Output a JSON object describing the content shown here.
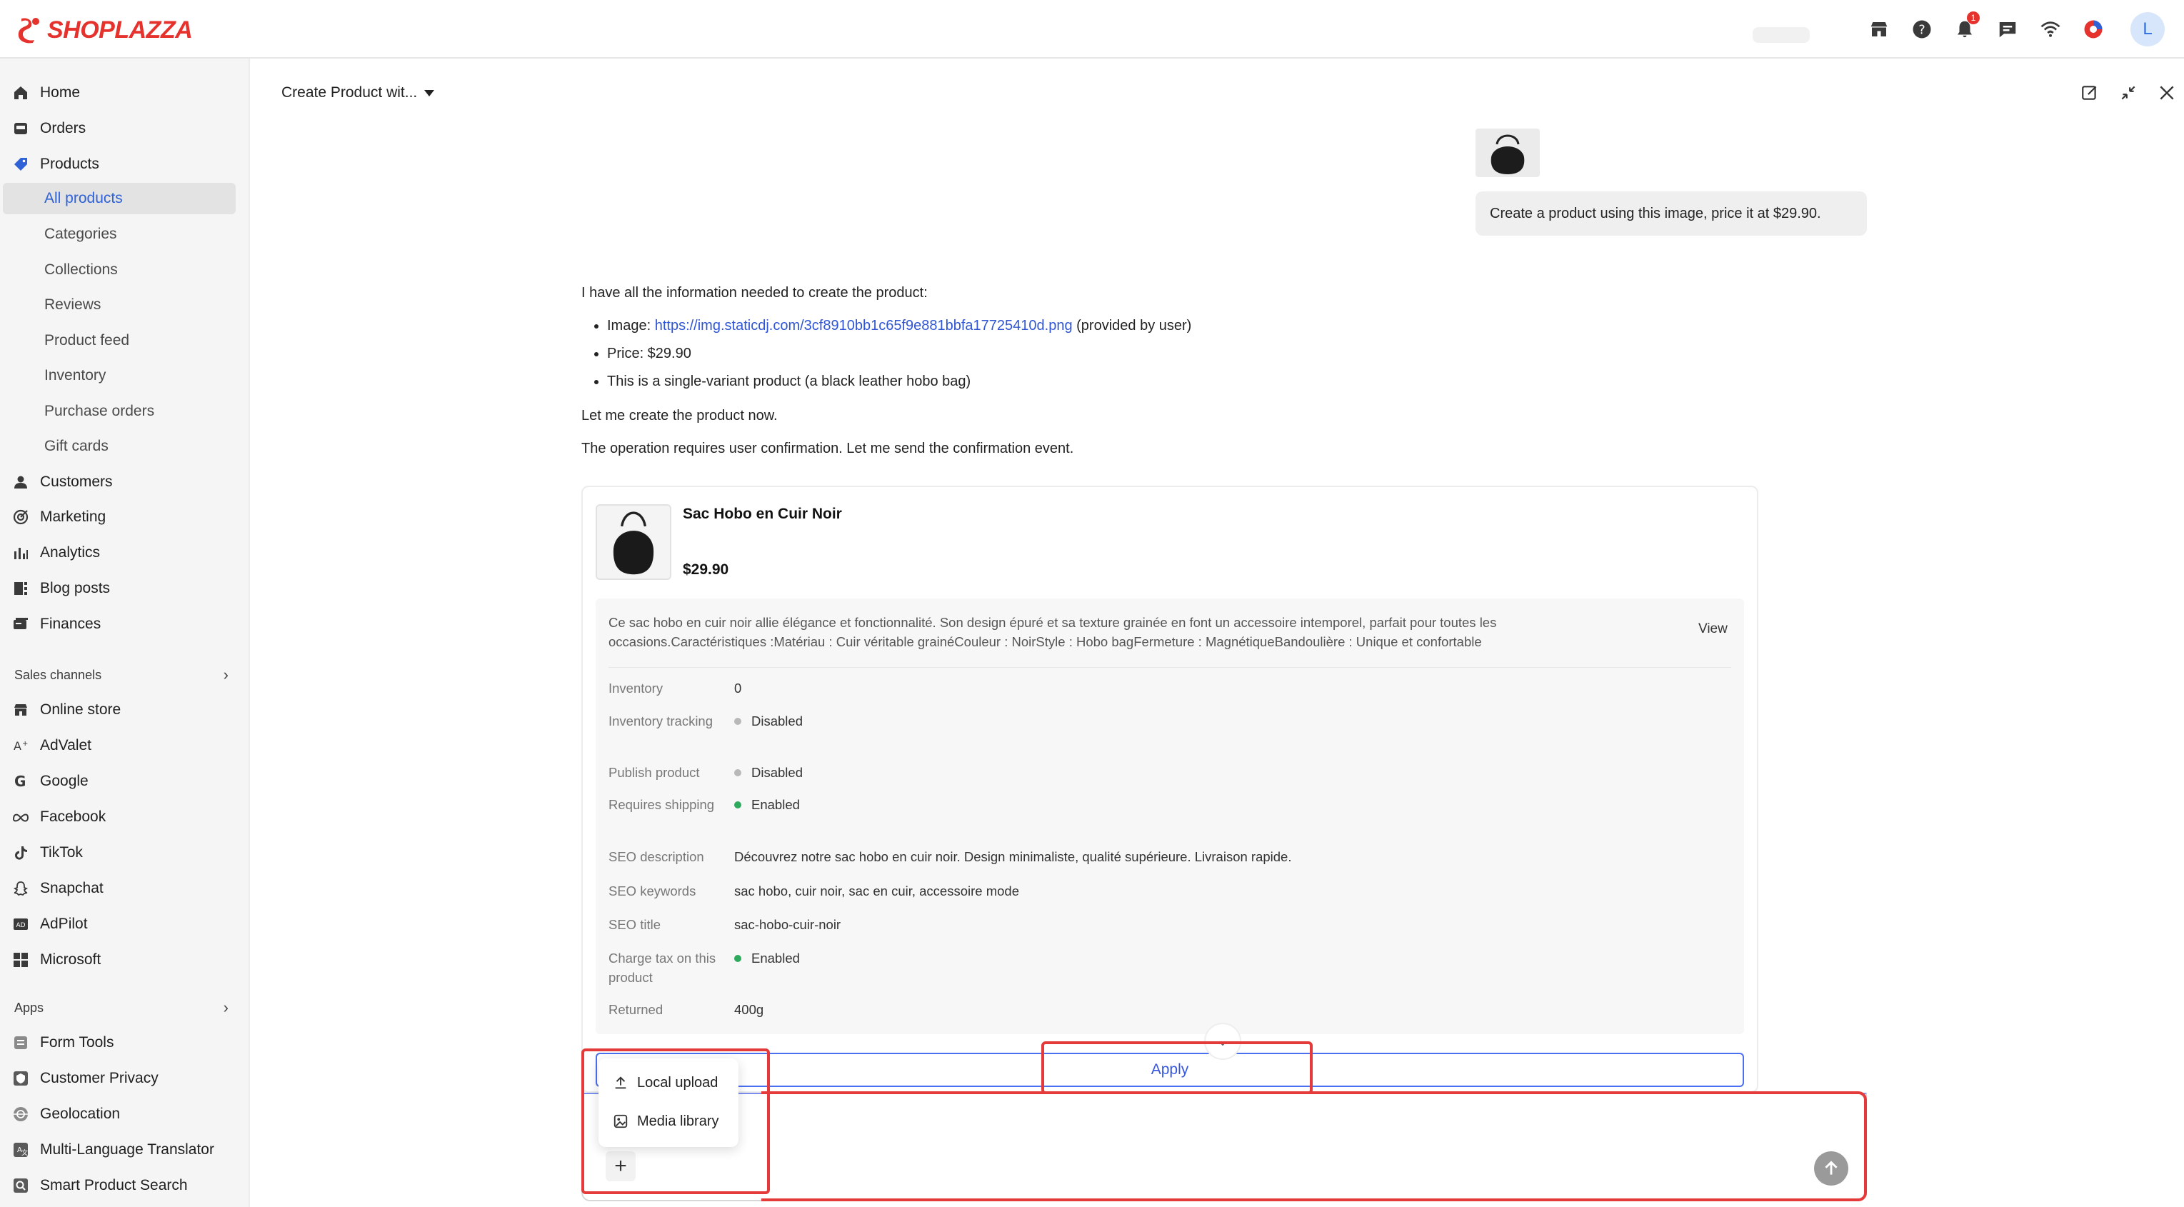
{
  "brand": {
    "name": "SHOPLAZZA",
    "color": "#e5322d"
  },
  "topbar": {
    "icons": [
      "store-icon",
      "help-icon",
      "bell-icon",
      "chat-icon",
      "wifi-icon",
      "color-circle-icon"
    ],
    "notification_count": "1",
    "avatar_initial": "L"
  },
  "sidebar": {
    "main": [
      {
        "label": "Home",
        "icon": "home-icon"
      },
      {
        "label": "Orders",
        "icon": "orders-icon"
      },
      {
        "label": "Products",
        "icon": "tag-icon"
      }
    ],
    "product_subs": [
      "All products",
      "Categories",
      "Collections",
      "Reviews",
      "Product feed",
      "Inventory",
      "Purchase orders",
      "Gift cards"
    ],
    "more": [
      {
        "label": "Customers",
        "icon": "person-icon"
      },
      {
        "label": "Marketing",
        "icon": "target-icon"
      },
      {
        "label": "Analytics",
        "icon": "bar-chart-icon"
      },
      {
        "label": "Blog posts",
        "icon": "blog-icon"
      },
      {
        "label": "Finances",
        "icon": "finance-icon"
      }
    ],
    "sales_channels_label": "Sales channels",
    "sales_channels": [
      {
        "label": "Online store",
        "icon": "store-icon"
      },
      {
        "label": "AdValet",
        "icon": "advalet-icon"
      },
      {
        "label": "Google",
        "icon": "google-icon"
      },
      {
        "label": "Facebook",
        "icon": "meta-icon"
      },
      {
        "label": "TikTok",
        "icon": "tiktok-icon"
      },
      {
        "label": "Snapchat",
        "icon": "snapchat-icon"
      },
      {
        "label": "AdPilot",
        "icon": "adpilot-icon"
      },
      {
        "label": "Microsoft",
        "icon": "microsoft-icon"
      }
    ],
    "apps_label": "Apps",
    "apps": [
      {
        "label": "Form Tools",
        "icon": "form-icon"
      },
      {
        "label": "Customer Privacy",
        "icon": "shield-icon"
      },
      {
        "label": "Geolocation",
        "icon": "globe-icon"
      },
      {
        "label": "Multi-Language Translator",
        "icon": "translate-icon"
      },
      {
        "label": "Smart Product Search",
        "icon": "search-icon"
      }
    ]
  },
  "chat": {
    "title": "Create Product wit...",
    "user_message": "Create a product using this image, price it at $29.90.",
    "assistant": {
      "intro": "I have all the information needed to create the product:",
      "image_prefix": "Image: ",
      "image_url": "https://img.staticdj.com/3cf8910bb1c65f9e881bbfa17725410d.png",
      "image_suffix": " (provided by user)",
      "price_line": "Price: $29.90",
      "variant_line": "This is a single-variant product (a black leather hobo bag)",
      "line2": "Let me create the product now.",
      "line3": "The operation requires user confirmation. Let me send the confirmation event."
    },
    "product": {
      "name": "Sac Hobo en Cuir Noir",
      "price": "$29.90",
      "description": "Ce sac hobo en cuir noir allie élégance et fonctionnalité. Son design épuré et sa texture grainée en font un accessoire intemporel, parfait pour toutes les occasions.Caractéristiques :Matériau : Cuir véritable grainéCouleur : NoirStyle : Hobo bagFermeture : MagnétiqueBandoulière : Unique et confortable",
      "view_label": "View",
      "rows": [
        {
          "label": "Inventory",
          "value": "0",
          "status": ""
        },
        {
          "label": "Inventory tracking",
          "value": "Disabled",
          "status": "grey"
        },
        {
          "label": "Publish product",
          "value": "Disabled",
          "status": "grey"
        },
        {
          "label": "Requires shipping",
          "value": "Enabled",
          "status": "green"
        },
        {
          "label": "SEO description",
          "value": "Découvrez notre sac hobo en cuir noir. Design minimaliste, qualité supérieure. Livraison rapide.",
          "status": ""
        },
        {
          "label": "SEO keywords",
          "value": "sac hobo, cuir noir, sac en cuir, accessoire mode",
          "status": ""
        },
        {
          "label": "SEO title",
          "value": "sac-hobo-cuir-noir",
          "status": ""
        },
        {
          "label": "Charge tax on this product",
          "value": "Enabled",
          "status": "green"
        },
        {
          "label": "Returned",
          "value": "400g",
          "status": ""
        }
      ],
      "apply_label": "Apply"
    },
    "upload_menu": {
      "local_upload": "Local upload",
      "media_library": "Media library"
    },
    "input": {
      "placeholder": ""
    }
  },
  "colors": {
    "accent": "#3556e0",
    "annotation": "#e53a3a",
    "enabled": "#2eaa5c"
  }
}
